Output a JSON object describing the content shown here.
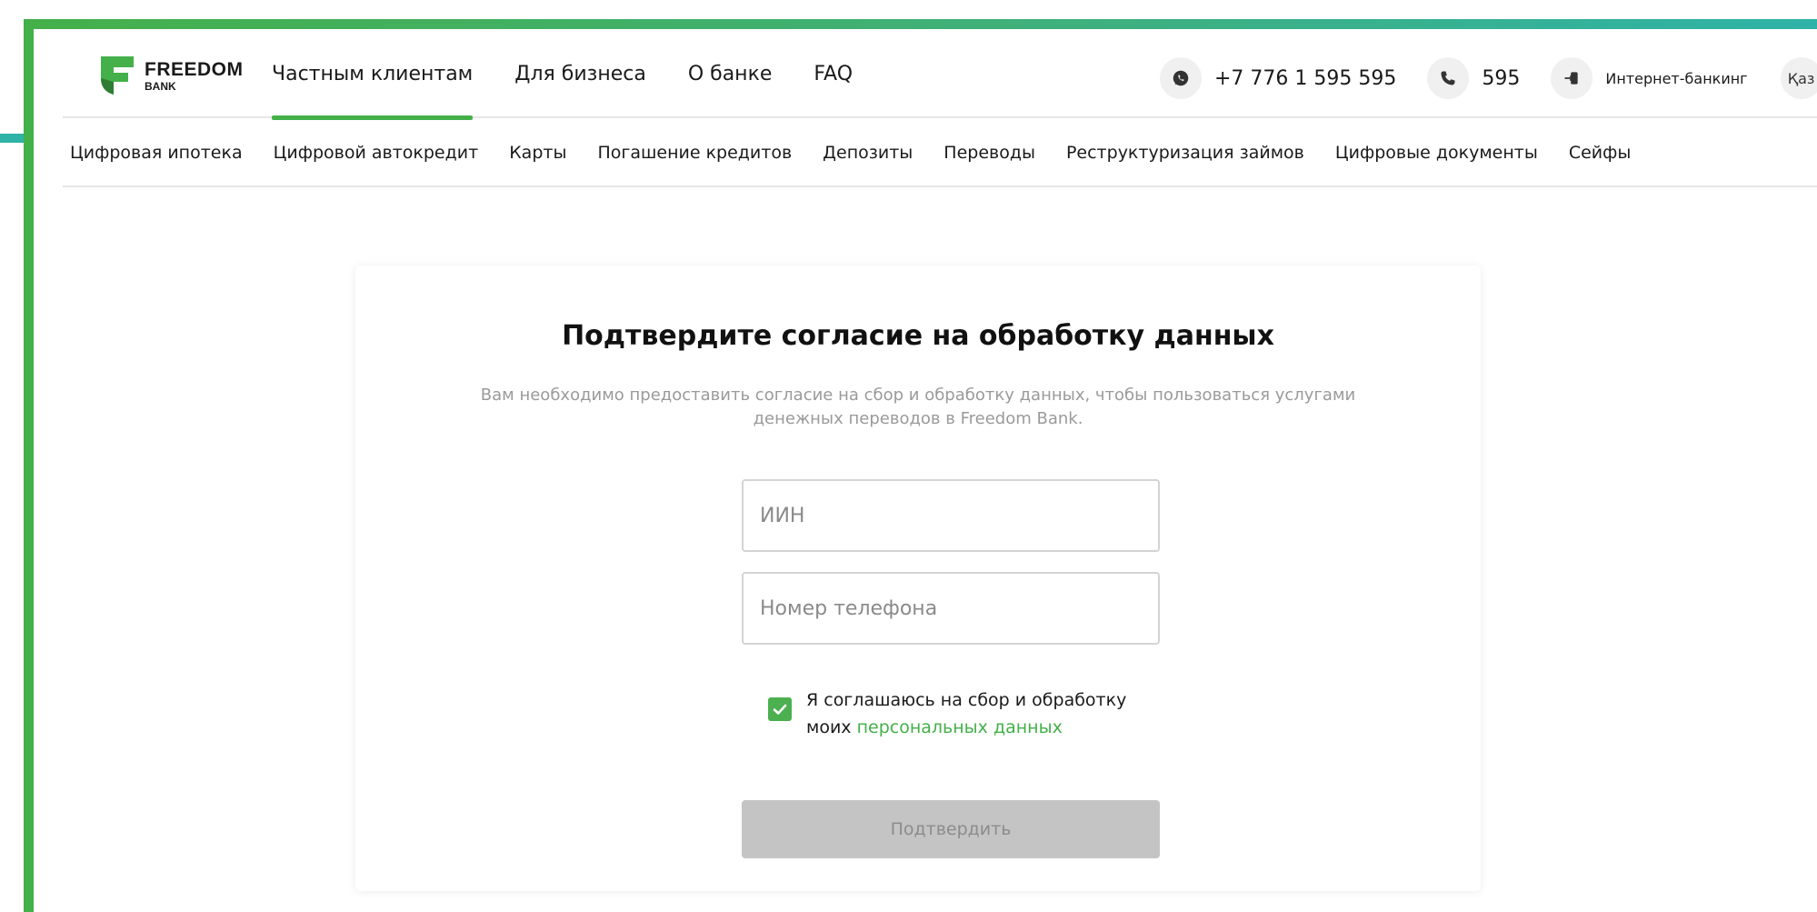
{
  "logo": {
    "line1": "FREEDOM",
    "line2": "BANK"
  },
  "main_nav": [
    {
      "label": "Частным клиентам",
      "active": true
    },
    {
      "label": "Для бизнеса",
      "active": false
    },
    {
      "label": "О банке",
      "active": false
    },
    {
      "label": "FAQ",
      "active": false
    }
  ],
  "contacts": {
    "whatsapp_number": "+7 776 1 595 595",
    "short_number": "595",
    "internet_banking": "Интернет-банкинг",
    "language": "Қаз"
  },
  "sub_nav": [
    "Цифровая ипотека",
    "Цифровой автокредит",
    "Карты",
    "Погашение кредитов",
    "Депозиты",
    "Переводы",
    "Реструктуризация займов",
    "Цифровые документы",
    "Сейфы"
  ],
  "form": {
    "title": "Подтвердите согласие на обработку данных",
    "description": "Вам необходимо предоставить согласие на сбор и обработку данных, чтобы пользоваться услугами денежных переводов в Freedom Bank.",
    "iin_placeholder": "ИИН",
    "phone_placeholder": "Номер телефона",
    "consent_text": "Я соглашаюсь на сбор и обработку моих",
    "consent_link": "персональных данных",
    "consent_checked": true,
    "submit_label": "Подтвердить"
  },
  "colors": {
    "brand_green": "#44b04a",
    "frame_teal": "#2fb3a7",
    "disabled_button": "#c4c4c4"
  }
}
